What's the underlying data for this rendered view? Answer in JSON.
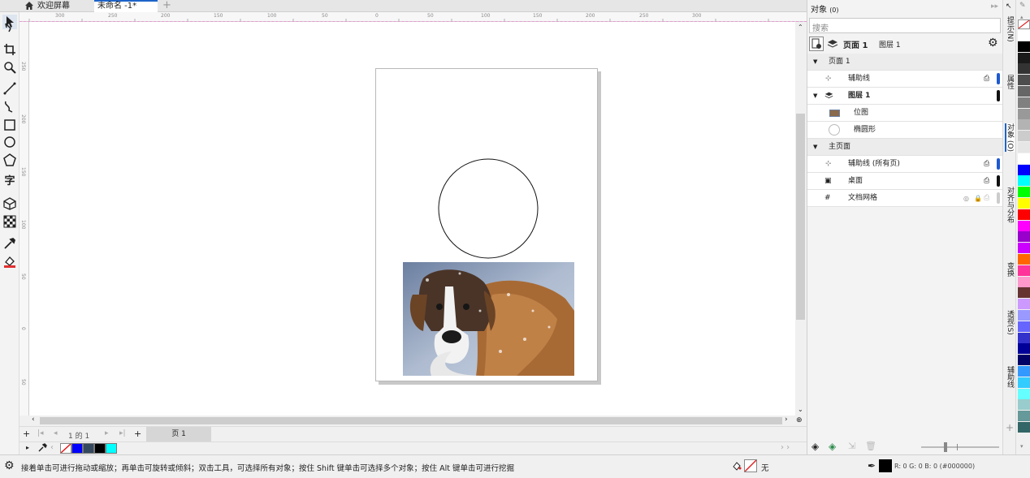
{
  "tabs": {
    "welcome": "欢迎屏幕",
    "document": "未命名 -1*"
  },
  "ruler": {
    "h_labels": [
      "300",
      "250",
      "200",
      "150",
      "100",
      "50",
      "0",
      "50",
      "100",
      "150",
      "200",
      "250",
      "300"
    ],
    "v_labels": [
      "250",
      "200",
      "150",
      "100",
      "50",
      "0",
      "50"
    ]
  },
  "docker": {
    "title": "对象",
    "title_count": "(0)",
    "search_placeholder": "搜索",
    "current_page": "页面 1",
    "current_layer": "图层 1",
    "rows": {
      "page1": "页面 1",
      "guides": "辅助线",
      "layer1": "图层 1",
      "bitmap": "位图",
      "ellipse": "椭圆形",
      "master": "主页面",
      "guides_all": "辅助线 (所有页)",
      "desktop": "桌面",
      "grid": "文档网格"
    }
  },
  "side_tabs": {
    "hints": "提示(N)",
    "properties": "属性",
    "objects": "对象 (O)",
    "align": "对齐与分布",
    "transform": "变换",
    "transparency": "透视(S)",
    "guides": "辅助线"
  },
  "pagebar": {
    "page_index": "1",
    "page_of": "的",
    "page_total": "1",
    "page_tab": "页 1"
  },
  "status": {
    "hint": "接着单击可进行拖动或缩放；再单击可旋转或倾斜；双击工具，可选择所有对象；按住 Shift 键单击可选择多个对象；按住 Alt 键单击可进行挖掘",
    "fill_label": "无",
    "outline_readout": "R: 0 G: 0 B: 0 (#000000)"
  },
  "colors": {
    "accent": "#1e64c8",
    "doc_palette": [
      "#ffffff",
      "#0000ff",
      "#34495e",
      "#000000",
      "#00ffff"
    ],
    "palette": [
      "#ffffff",
      "#000000",
      "#1a1a1a",
      "#333333",
      "#4d4d4d",
      "#666666",
      "#808080",
      "#999999",
      "#b3b3b3",
      "#cccccc",
      "#e6e6e6",
      "#ffffff",
      "#0000ff",
      "#00ffff",
      "#00ff00",
      "#ffff00",
      "#ff0000",
      "#ff00ff",
      "#9900cc",
      "#cc00ff",
      "#ff6600",
      "#ff3399",
      "#ff99cc",
      "#663333",
      "#cc99ff",
      "#9999ff",
      "#6666ff",
      "#3333cc",
      "#000099",
      "#000066",
      "#3399ff",
      "#33ccff",
      "#66ffff",
      "#99cccc",
      "#669999",
      "#336666"
    ]
  }
}
